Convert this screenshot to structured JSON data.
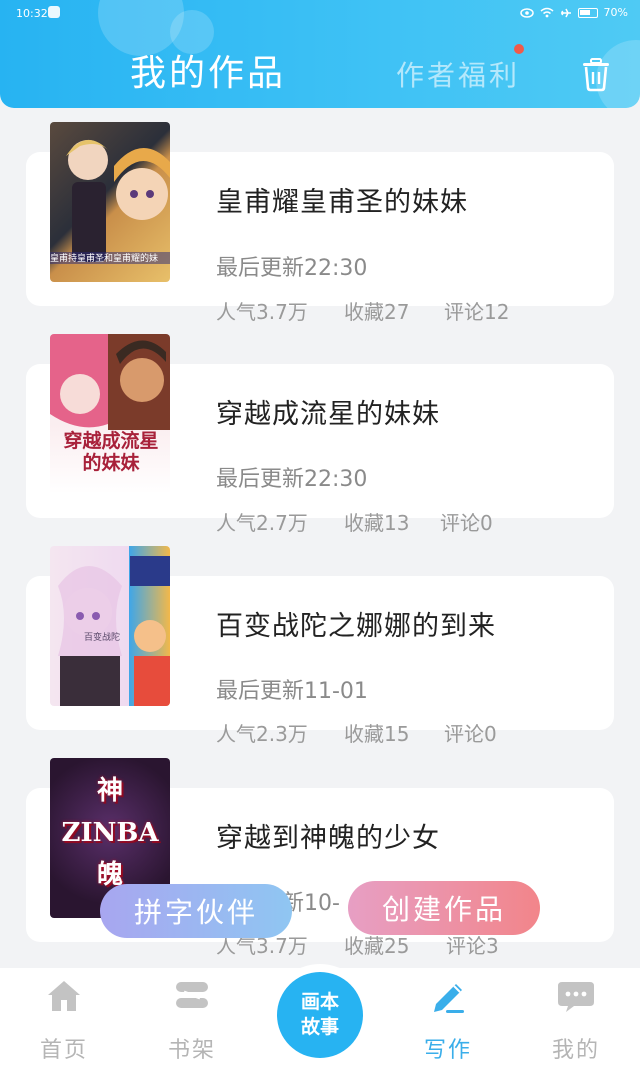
{
  "status_bar": {
    "time": "10:32",
    "battery": "70%"
  },
  "header": {
    "title": "我的作品",
    "welfare": "作者福利",
    "trash_icon": "trash-icon"
  },
  "works": [
    {
      "title": "皇甫耀皇甫圣的妹妹",
      "updated": "最后更新22:30",
      "popularity": "人气3.7万",
      "favorites": "收藏27",
      "comments": "评论12",
      "cover_caption": "皇甫持皇甫圣和皇甫耀的妹"
    },
    {
      "title": "穿越成流星的妹妹",
      "updated": "最后更新22:30",
      "popularity": "人气2.7万",
      "favorites": "收藏13",
      "comments": "评论0",
      "cover_caption": "穿越成流星的妹妹"
    },
    {
      "title": "百变战陀之娜娜的到来",
      "updated": "最后更新11-01",
      "popularity": "人气2.3万",
      "favorites": "收藏15",
      "comments": "评论0",
      "cover_caption": "百变战陀"
    },
    {
      "title": "穿越到神魄的少女",
      "updated": "最后更新10-",
      "popularity": "人气3.7万",
      "favorites": "收藏25",
      "comments": "评论3",
      "cover_caption": "神 ZINBA 魄"
    }
  ],
  "actions": {
    "partner": "拼字伙伴",
    "create": "创建作品"
  },
  "bottom_nav": [
    {
      "label": "首页",
      "icon": "home-icon"
    },
    {
      "label": "书架",
      "icon": "bookshelf-icon"
    },
    {
      "label": "写作",
      "icon": "pen-icon"
    },
    {
      "label": "我的",
      "icon": "chat-icon"
    }
  ],
  "center_button": {
    "line1": "画本",
    "line2": "故事"
  },
  "colors": {
    "accent": "#27b3f2",
    "active_nav": "#3aaeea"
  }
}
